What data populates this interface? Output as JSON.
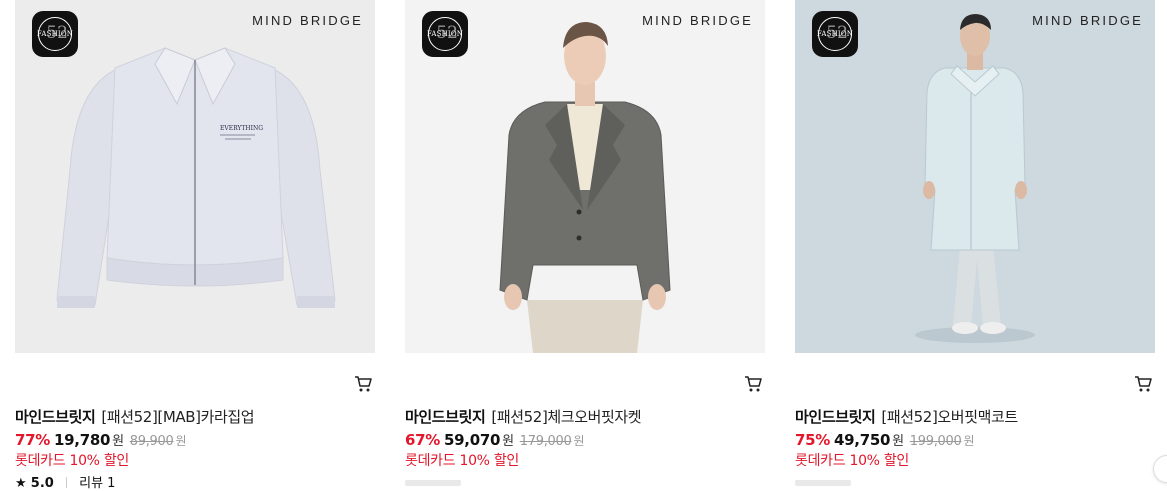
{
  "badge": {
    "label": "FASHION",
    "number": "52"
  },
  "brand_mark": "MIND BRIDGE",
  "products": [
    {
      "brand": "마인드브릿지",
      "name": "[패션52][MAB]카라집업",
      "discount": "77%",
      "price": "19,780",
      "currency": "원",
      "original_price": "89,900",
      "promo": "롯데카드 10% 할인",
      "rating": "5.0",
      "reviews": "리뷰 1",
      "image": "light-gray-zip-up-jacket"
    },
    {
      "brand": "마인드브릿지",
      "name": "[패션52]체크오버핏자켓",
      "discount": "67%",
      "price": "59,070",
      "currency": "원",
      "original_price": "179,000",
      "promo": "롯데카드 10% 할인",
      "image": "model-in-gray-check-blazer"
    },
    {
      "brand": "마인드브릿지",
      "name": "[패션52]오버핏맥코트",
      "discount": "75%",
      "price": "49,750",
      "currency": "원",
      "original_price": "199,000",
      "promo": "롯데카드 10% 할인",
      "image": "model-in-mint-mac-coat"
    }
  ],
  "colors": {
    "discount": "#e3162b",
    "promo": "#e3162b",
    "badge": "#111111"
  },
  "icons": {
    "cart": "cart-icon",
    "star": "star-icon"
  }
}
